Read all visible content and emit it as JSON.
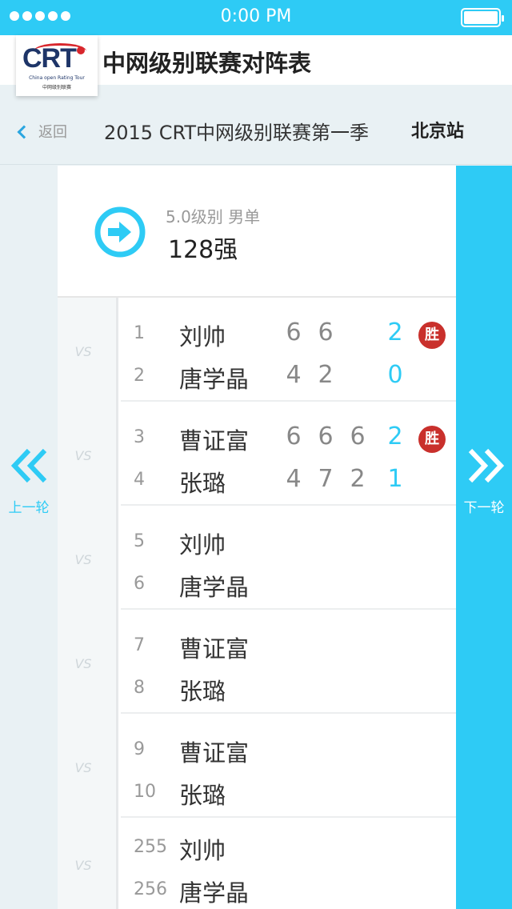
{
  "status_bar": {
    "time": "0:00 PM"
  },
  "header": {
    "logo_text": "CRT",
    "logo_subtitle": "China open Rating Tour",
    "logo_subtitle_cn": "中网级别联赛",
    "title": "中网级别联赛对阵表"
  },
  "nav": {
    "back_label": "返回",
    "season": "2015 CRT中网级别联赛第一季",
    "station": "北京站"
  },
  "side": {
    "prev_label": "上一轮",
    "next_label": "下一轮"
  },
  "round": {
    "category": "5.0级别 男单",
    "size": "128强"
  },
  "vs_label": "VS",
  "win_label": "胜",
  "matches": [
    {
      "p1": {
        "seed": "1",
        "name": "刘帅",
        "scores": [
          "6",
          "6"
        ],
        "total": "2",
        "winner": true
      },
      "p2": {
        "seed": "2",
        "name": "唐学晶",
        "scores": [
          "4",
          "2"
        ],
        "total": "0",
        "winner": false
      }
    },
    {
      "p1": {
        "seed": "3",
        "name": "曹证富",
        "scores": [
          "6",
          "6",
          "6"
        ],
        "total": "2",
        "winner": true
      },
      "p2": {
        "seed": "4",
        "name": "张璐",
        "scores": [
          "4",
          "7",
          "2"
        ],
        "total": "1",
        "winner": false
      }
    },
    {
      "p1": {
        "seed": "5",
        "name": "刘帅",
        "scores": [],
        "total": "",
        "winner": false
      },
      "p2": {
        "seed": "6",
        "name": "唐学晶",
        "scores": [],
        "total": "",
        "winner": false
      }
    },
    {
      "p1": {
        "seed": "7",
        "name": "曹证富",
        "scores": [],
        "total": "",
        "winner": false
      },
      "p2": {
        "seed": "8",
        "name": "张璐",
        "scores": [],
        "total": "",
        "winner": false
      }
    },
    {
      "p1": {
        "seed": "9",
        "name": "曹证富",
        "scores": [],
        "total": "",
        "winner": false
      },
      "p2": {
        "seed": "10",
        "name": "张璐",
        "scores": [],
        "total": "",
        "winner": false
      }
    },
    {
      "p1": {
        "seed": "255",
        "name": "刘帅",
        "scores": [],
        "total": "",
        "winner": false
      },
      "p2": {
        "seed": "256",
        "name": "唐学晶",
        "scores": [],
        "total": "",
        "winner": false
      }
    }
  ],
  "colors": {
    "accent": "#2ecbf5",
    "win_badge": "#c9302c",
    "text": "#333333",
    "muted": "#999999"
  }
}
